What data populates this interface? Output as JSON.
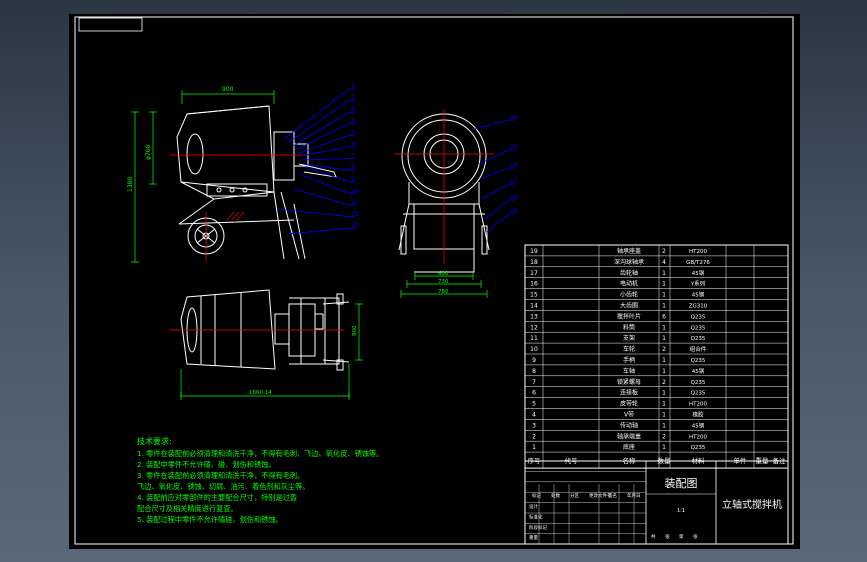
{
  "drawing": {
    "title_block": {
      "drawing_type": "装配图",
      "product_name": "立轴式搅拌机",
      "row_labels": [
        "标记",
        "处数",
        "分区",
        "更改文件号",
        "签名",
        "年月日"
      ],
      "small_labels": [
        "设计",
        "标准化",
        "阶段标记",
        "重量",
        "比例",
        "审核",
        "工艺",
        "批准",
        "共",
        "张",
        "第",
        "张"
      ],
      "scale": "1:1"
    },
    "bom": {
      "columns": [
        "序号",
        "代号",
        "名称",
        "数量",
        "材料",
        "单件",
        "总计",
        "重量",
        "备注"
      ],
      "rows": [
        {
          "no": "19",
          "name": "轴承座盖",
          "qty": "2",
          "material": "HT200"
        },
        {
          "no": "18",
          "name": "深沟球轴承",
          "qty": "4",
          "material": "GB/T276"
        },
        {
          "no": "17",
          "name": "齿轮轴",
          "qty": "1",
          "material": "45钢"
        },
        {
          "no": "16",
          "name": "电动机",
          "qty": "1",
          "material": "Y系列"
        },
        {
          "no": "15",
          "name": "小齿轮",
          "qty": "1",
          "material": "45钢"
        },
        {
          "no": "14",
          "name": "大齿圈",
          "qty": "1",
          "material": "ZG310"
        },
        {
          "no": "13",
          "name": "搅拌叶片",
          "qty": "6",
          "material": "Q235"
        },
        {
          "no": "12",
          "name": "料筒",
          "qty": "1",
          "material": "Q235"
        },
        {
          "no": "11",
          "name": "支架",
          "qty": "1",
          "material": "Q235"
        },
        {
          "no": "10",
          "name": "车轮",
          "qty": "2",
          "material": "组合件"
        },
        {
          "no": "9",
          "name": "手柄",
          "qty": "1",
          "material": "Q235"
        },
        {
          "no": "8",
          "name": "车轴",
          "qty": "1",
          "material": "45钢"
        },
        {
          "no": "7",
          "name": "锁紧螺母",
          "qty": "2",
          "material": "Q235"
        },
        {
          "no": "6",
          "name": "连接板",
          "qty": "1",
          "material": "Q235"
        },
        {
          "no": "5",
          "name": "皮带轮",
          "qty": "1",
          "material": "HT200"
        },
        {
          "no": "4",
          "name": "V带",
          "qty": "1",
          "material": "橡胶"
        },
        {
          "no": "3",
          "name": "传动轴",
          "qty": "1",
          "material": "45钢"
        },
        {
          "no": "2",
          "name": "轴承端盖",
          "qty": "2",
          "material": "HT200"
        },
        {
          "no": "1",
          "name": "底座",
          "qty": "1",
          "material": "Q235"
        }
      ]
    },
    "notes": {
      "heading": "技术要求:",
      "lines": [
        "1. 零件在装配前必须清理和清洗干净，不得有毛刺、飞边、氧化皮、锈蚀等。",
        "2. 装配中零件不允许磕、碰、划伤和锈蚀。",
        "3. 零件在装配前必须清理和清洗干净，不得有毛刺。",
        "飞边、氧化皮、锈蚀、切屑、油污、着色剂和灰尘等。",
        "4. 装配前应对零部件的主要配合尺寸，特别是过盈",
        "配合尺寸及相关精度进行复查。",
        "5. 装配过程中零件不允许磕碰，划伤和锈蚀。"
      ]
    },
    "dimensions": {
      "front_width": "900",
      "front_dia": "φ700",
      "front_height": "1380",
      "side_width1": "600",
      "side_width2": "730",
      "side_width3": "780",
      "top_length": "1660.14",
      "top_height": "800"
    },
    "balloons_front": [
      "1",
      "2",
      "3",
      "4",
      "5",
      "6",
      "7",
      "8",
      "9",
      "10",
      "11",
      "12",
      "13"
    ],
    "balloons_side": [
      "14",
      "15",
      "16",
      "17",
      "18",
      "19"
    ],
    "colors": {
      "frame": "#ffffff",
      "geometry": "#ffffff",
      "dimension": "#00ff00",
      "leader": "#0000ff",
      "center": "#ff0000",
      "notes": "#00ff00"
    }
  }
}
